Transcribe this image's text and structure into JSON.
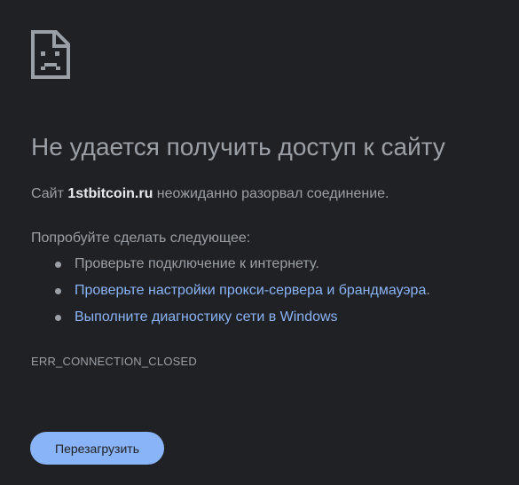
{
  "icon": "sad-page-icon",
  "title": "Не удается получить доступ к сайту",
  "description": {
    "prefix": "Сайт ",
    "host": "1stbitcoin.ru",
    "suffix": " неожиданно разорвал соединение."
  },
  "suggestions": {
    "heading": "Попробуйте сделать следующее:",
    "items": [
      {
        "text": "Проверьте подключение к интернету.",
        "link": false
      },
      {
        "text": "Проверьте настройки прокси-сервера и брандмауэра",
        "link": true,
        "trailing": "."
      },
      {
        "text": "Выполните диагностику сети в Windows",
        "link": true,
        "trailing": ""
      }
    ]
  },
  "error_code": "ERR_CONNECTION_CLOSED",
  "reload_button": "Перезагрузить",
  "colors": {
    "background": "#202124",
    "text": "#9aa0a6",
    "host": "#e8eaed",
    "link": "#8ab4f8",
    "button": "#8ab4f8"
  }
}
